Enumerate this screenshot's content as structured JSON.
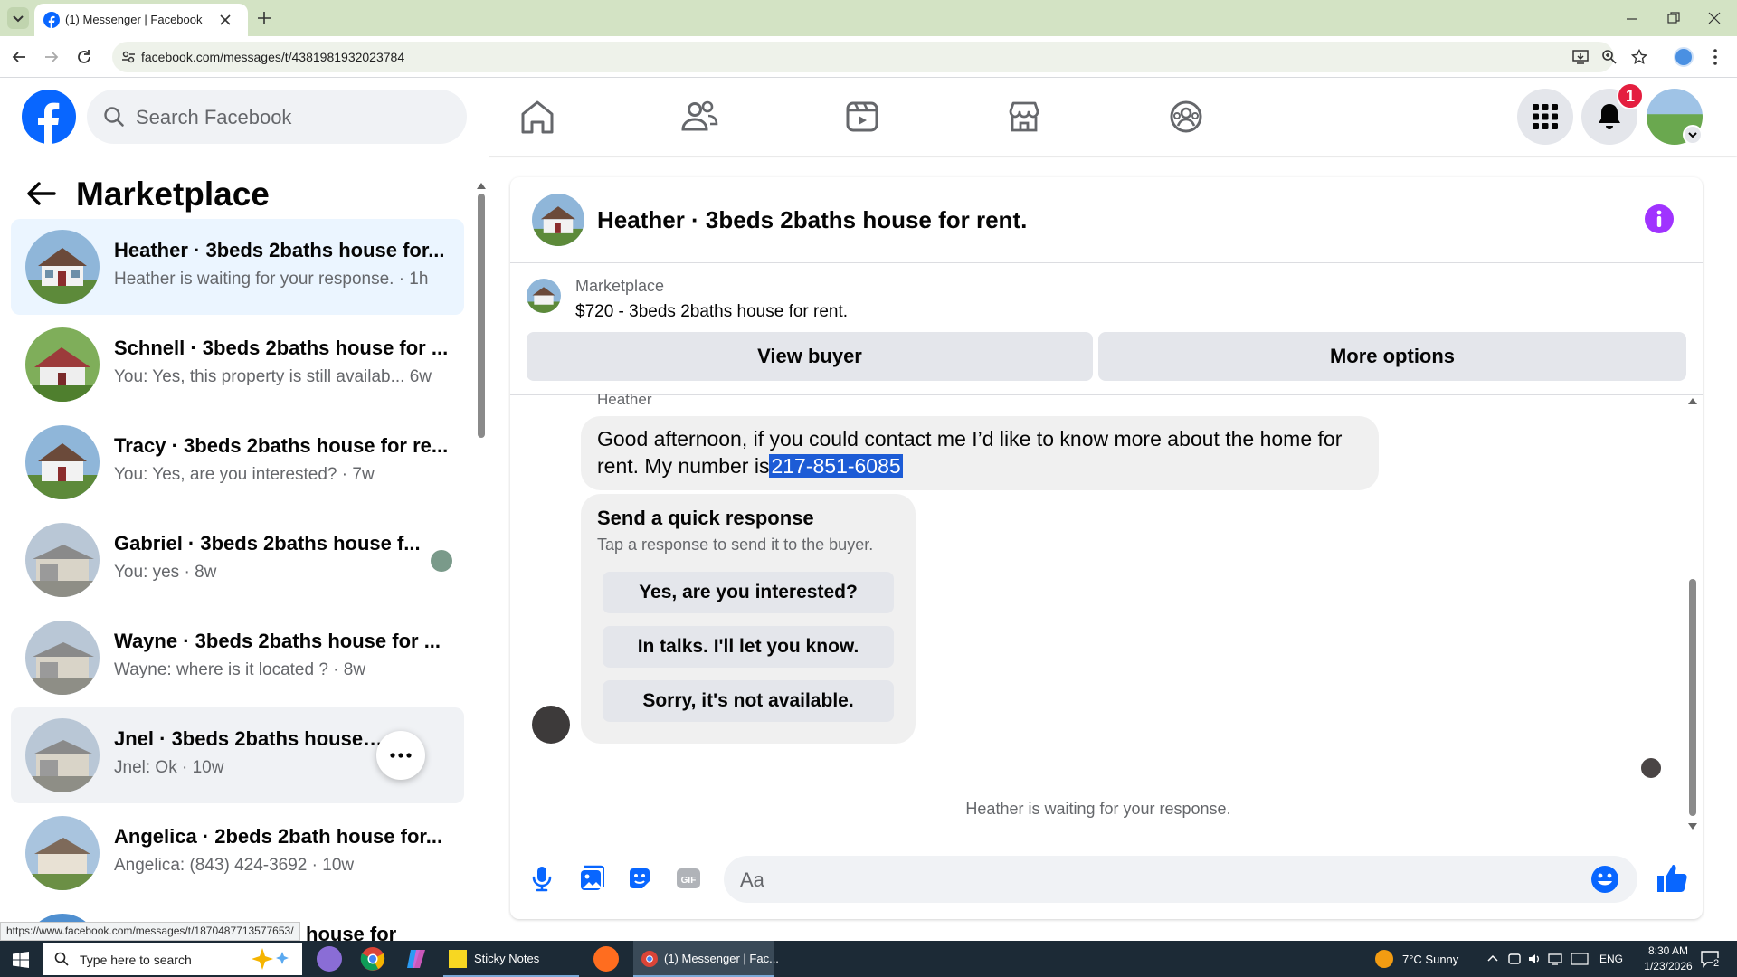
{
  "browser": {
    "tab_title": "(1) Messenger | Facebook",
    "url": "facebook.com/messages/t/4381981932023784",
    "status_url": "https://www.facebook.com/messages/t/1870487713577653/"
  },
  "fb_header": {
    "search_placeholder": "Search Facebook",
    "notification_count": "1"
  },
  "sidebar": {
    "title": "Marketplace",
    "conversations": [
      {
        "name": "Heather · 3beds 2baths house for...",
        "preview": "Heather is waiting for your response. · 1h"
      },
      {
        "name": "Schnell · 3beds 2baths house for ...",
        "preview": "You: Yes, this property is still availab...  6w"
      },
      {
        "name": "Tracy · 3beds 2baths house for re...",
        "preview": "You: Yes, are you interested? · 7w"
      },
      {
        "name": "Gabriel · 3beds 2baths house f...",
        "preview": "You: yes · 8w"
      },
      {
        "name": "Wayne · 3beds 2baths house for ...",
        "preview": "Wayne: where is it located ? · 8w"
      },
      {
        "name": "Jnel · 3beds 2baths house for rent.",
        "preview": "Jnel: Ok · 10w"
      },
      {
        "name": "Angelica · 2beds 2bath house for...",
        "preview": "Angelica: (843) 424-3692 · 10w"
      },
      {
        "name": "house for",
        "preview": ""
      }
    ]
  },
  "chat": {
    "title": "Heather · 3beds 2baths house for rent.",
    "listing_label": "Marketplace",
    "listing_detail": "$720 - 3beds 2baths house for rent.",
    "view_buyer": "View buyer",
    "more_options": "More options",
    "sender": "Heather",
    "message_part1": "Good afternoon, if you could contact me I’d like to know more about the home for rent. My number is",
    "message_phone": "217-851-6085",
    "quick_title": "Send a quick response",
    "quick_sub": "Tap a response to send it to the buyer.",
    "quick_responses": [
      "Yes, are you interested?",
      "In talks. I'll let you know.",
      "Sorry, it's not available."
    ],
    "waiting_note": "Heather is waiting for your response.",
    "composer_placeholder": "Aa"
  },
  "taskbar": {
    "search_placeholder": "Type here to search",
    "app_sticky": "Sticky Notes",
    "app_messenger": "(1) Messenger | Fac...",
    "weather": "7°C  Sunny",
    "lang": "ENG",
    "time": "8:30 AM",
    "date": "1/23/2026",
    "notif_count": "2"
  },
  "colors": {
    "fb_blue": "#0866ff",
    "chrome_frame": "#d3e3c4",
    "selection": "#1d5cd6",
    "badge_red": "#e41e3f",
    "info_purple": "#a033ff"
  },
  "icons": [
    "facebook-logo-icon",
    "search-icon",
    "home-icon",
    "friends-icon",
    "video-icon",
    "marketplace-icon",
    "groups-icon",
    "menu-grid-icon",
    "bell-icon",
    "back-arrow-icon",
    "info-icon",
    "mic-icon",
    "photo-icon",
    "sticker-icon",
    "gif-icon",
    "emoji-icon",
    "like-icon"
  ]
}
